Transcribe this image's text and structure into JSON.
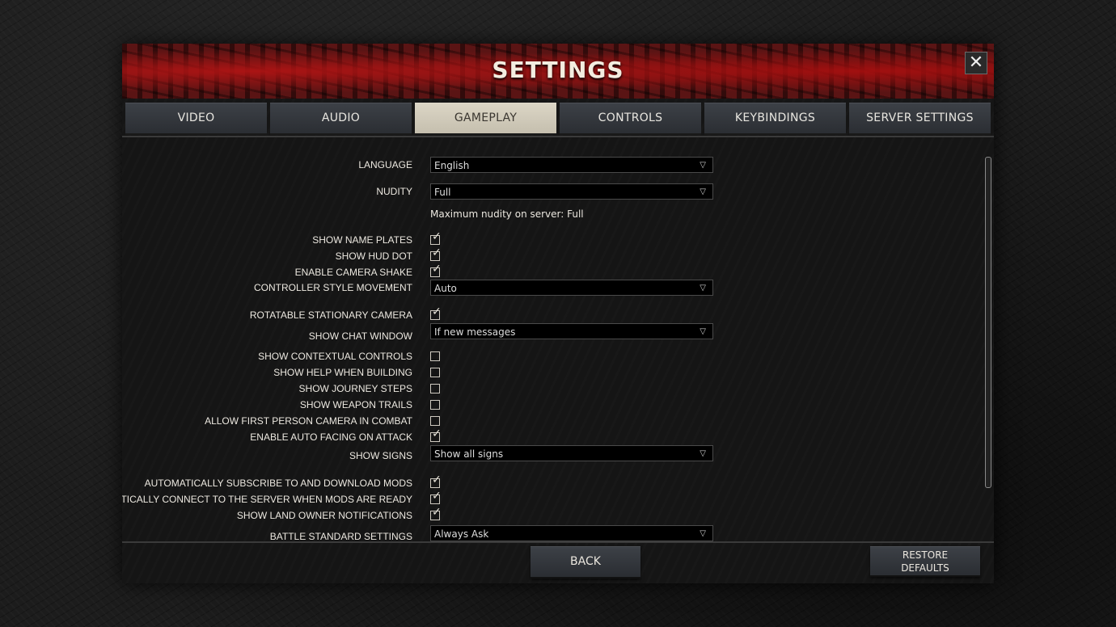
{
  "header": {
    "title": "SETTINGS",
    "close_glyph": "✕"
  },
  "tabs": [
    {
      "label": "VIDEO",
      "active": false
    },
    {
      "label": "AUDIO",
      "active": false
    },
    {
      "label": "GAMEPLAY",
      "active": true
    },
    {
      "label": "CONTROLS",
      "active": false
    },
    {
      "label": "KEYBINDINGS",
      "active": false
    },
    {
      "label": "SERVER SETTINGS",
      "active": false
    }
  ],
  "settings": {
    "language": {
      "label": "LANGUAGE",
      "value": "English"
    },
    "nudity": {
      "label": "NUDITY",
      "value": "Full",
      "note": "Maximum nudity on server: Full"
    },
    "show_name_plates": {
      "label": "SHOW NAME PLATES",
      "checked": true
    },
    "show_hud_dot": {
      "label": "SHOW HUD DOT",
      "checked": true
    },
    "enable_camera_shake": {
      "label": "ENABLE CAMERA SHAKE",
      "checked": true
    },
    "controller_style_movement": {
      "label": "CONTROLLER STYLE MOVEMENT",
      "value": "Auto"
    },
    "rotatable_stationary_camera": {
      "label": "ROTATABLE STATIONARY CAMERA",
      "checked": true
    },
    "show_chat_window": {
      "label": "SHOW CHAT WINDOW",
      "value": "If new messages"
    },
    "show_contextual_controls": {
      "label": "SHOW CONTEXTUAL CONTROLS",
      "checked": false
    },
    "show_help_when_building": {
      "label": "SHOW HELP WHEN BUILDING",
      "checked": false
    },
    "show_journey_steps": {
      "label": "SHOW JOURNEY STEPS",
      "checked": false
    },
    "show_weapon_trails": {
      "label": "SHOW WEAPON TRAILS",
      "checked": false
    },
    "allow_first_person_camera": {
      "label": "ALLOW FIRST PERSON CAMERA IN COMBAT",
      "checked": false
    },
    "enable_auto_facing": {
      "label": "ENABLE AUTO FACING ON ATTACK",
      "checked": true
    },
    "show_signs": {
      "label": "SHOW SIGNS",
      "value": "Show all signs"
    },
    "auto_subscribe_mods": {
      "label": "AUTOMATICALLY SUBSCRIBE TO AND DOWNLOAD MODS",
      "checked": true
    },
    "auto_connect_server": {
      "label": "AUTOMATICALLY CONNECT TO THE SERVER WHEN MODS ARE READY",
      "checked": true
    },
    "show_land_owner": {
      "label": "SHOW LAND OWNER NOTIFICATIONS",
      "checked": true
    },
    "battle_standard": {
      "label": "BATTLE STANDARD SETTINGS",
      "value": "Always Ask"
    }
  },
  "dropdown_arrow": "▽",
  "checkmark": "✓",
  "footer": {
    "back_label": "BACK",
    "restore_line1": "RESTORE",
    "restore_line2": "DEFAULTS"
  }
}
